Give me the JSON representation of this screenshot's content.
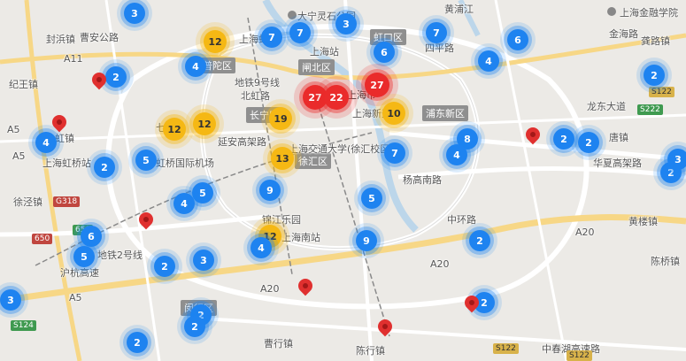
{
  "districts": [
    {
      "id": "putuo",
      "label": "普陀区"
    },
    {
      "id": "zhabei",
      "label": "闸北区"
    },
    {
      "id": "hongkou",
      "label": "虹口区"
    },
    {
      "id": "changning",
      "label": "长宁区"
    },
    {
      "id": "pudong",
      "label": "浦东新区"
    },
    {
      "id": "xuhui",
      "label": "徐汇区"
    },
    {
      "id": "minhang",
      "label": "闵行区"
    }
  ],
  "labels": [
    {
      "id": "fengbang",
      "text": "封浜镇"
    },
    {
      "id": "caojia",
      "text": "曹安公路"
    },
    {
      "id": "jiwang",
      "text": "纪王镇"
    },
    {
      "id": "hongqiao-zhen",
      "text": "虹镇"
    },
    {
      "id": "hongqiao-airport-station",
      "text": "上海虹桥站"
    },
    {
      "id": "hongqiao-airport",
      "text": "虹桥国际机场"
    },
    {
      "id": "xujing",
      "text": "徐泾镇"
    },
    {
      "id": "ditie2",
      "text": "地铁2号线"
    },
    {
      "id": "ditie9",
      "text": "地铁9号线"
    },
    {
      "id": "huangjiang",
      "text": "黄浦江"
    },
    {
      "id": "jinhai",
      "text": "金海路"
    },
    {
      "id": "gongyuan",
      "text": "龚路镇"
    },
    {
      "id": "longdong",
      "text": "龙东大道"
    },
    {
      "id": "tangzhen",
      "text": "唐镇"
    },
    {
      "id": "huaxia",
      "text": "华夏高架路"
    },
    {
      "id": "huanglou",
      "text": "黄楼镇"
    },
    {
      "id": "chenhang",
      "text": "陈桥镇"
    },
    {
      "id": "zhonghuan",
      "text": "中环路"
    },
    {
      "id": "yangg",
      "text": "杨高南路"
    },
    {
      "id": "shanghai-south",
      "text": "上海南站"
    },
    {
      "id": "sjtu",
      "text": "上海交通大学(徐汇校区)"
    },
    {
      "id": "dangyin",
      "text": "大宁灵石公园"
    },
    {
      "id": "shanghaishi",
      "text": "上海市"
    },
    {
      "id": "shanghai-jinrong",
      "text": "上海金融学院"
    },
    {
      "id": "ditie-yanan",
      "text": "延安高架路"
    },
    {
      "id": "a20",
      "text": "A20"
    },
    {
      "id": "a20b",
      "text": "A20"
    },
    {
      "id": "a20c",
      "text": "A20"
    },
    {
      "id": "a11",
      "text": "A11"
    },
    {
      "id": "a5",
      "text": "A5"
    },
    {
      "id": "a5b",
      "text": "A5"
    },
    {
      "id": "a5c",
      "text": "A5"
    },
    {
      "id": "jinjiang",
      "text": "锦江乐园"
    },
    {
      "id": "caohang",
      "text": "曹行镇"
    },
    {
      "id": "chenhuang",
      "text": "陈行镇"
    },
    {
      "id": "zhongchun",
      "text": "中春湖高速路"
    },
    {
      "id": "shanghai-yuan",
      "text": "上海虹桥"
    },
    {
      "id": "xinxin",
      "text": "上海新天地"
    },
    {
      "id": "sishui",
      "text": "四平路"
    },
    {
      "id": "beihu",
      "text": "北虹路"
    },
    {
      "id": "qibao",
      "text": "七宝镇"
    },
    {
      "id": "shanghai-nanjing",
      "text": "上海站"
    },
    {
      "id": "songjiang",
      "text": "沪杭高速"
    }
  ],
  "shields": [
    {
      "id": "g318",
      "text": "G318",
      "tone": "red"
    },
    {
      "id": "s124",
      "text": "S124",
      "tone": "green"
    },
    {
      "id": "s122",
      "text": "S122",
      "tone": "yellow"
    },
    {
      "id": "s122b",
      "text": "S122",
      "tone": "yellow"
    },
    {
      "id": "s650",
      "text": "650",
      "tone": "red"
    },
    {
      "id": "s650b",
      "text": "650",
      "tone": "green"
    },
    {
      "id": "s222",
      "text": "S222",
      "tone": "green"
    },
    {
      "id": "s122c",
      "text": "S122",
      "tone": "yellow"
    }
  ],
  "clusters": [
    {
      "count": "3",
      "tone": "blue"
    },
    {
      "count": "12",
      "tone": "yellow"
    },
    {
      "count": "7",
      "tone": "blue"
    },
    {
      "count": "7",
      "tone": "blue"
    },
    {
      "count": "3",
      "tone": "blue"
    },
    {
      "count": "7",
      "tone": "blue"
    },
    {
      "count": "6",
      "tone": "blue"
    },
    {
      "count": "4",
      "tone": "blue"
    },
    {
      "count": "6",
      "tone": "blue"
    },
    {
      "count": "2",
      "tone": "blue"
    },
    {
      "count": "2",
      "tone": "blue"
    },
    {
      "count": "4",
      "tone": "blue"
    },
    {
      "count": "27",
      "tone": "red"
    },
    {
      "count": "22",
      "tone": "red"
    },
    {
      "count": "27",
      "tone": "red"
    },
    {
      "count": "12",
      "tone": "yellow"
    },
    {
      "count": "12",
      "tone": "yellow"
    },
    {
      "count": "19",
      "tone": "yellow"
    },
    {
      "count": "10",
      "tone": "yellow"
    },
    {
      "count": "4",
      "tone": "blue"
    },
    {
      "count": "2",
      "tone": "blue"
    },
    {
      "count": "5",
      "tone": "blue"
    },
    {
      "count": "13",
      "tone": "yellow"
    },
    {
      "count": "7",
      "tone": "blue"
    },
    {
      "count": "8",
      "tone": "blue"
    },
    {
      "count": "4",
      "tone": "blue"
    },
    {
      "count": "2",
      "tone": "blue"
    },
    {
      "count": "2",
      "tone": "blue"
    },
    {
      "count": "2",
      "tone": "blue"
    },
    {
      "count": "3",
      "tone": "blue"
    },
    {
      "count": "5",
      "tone": "blue"
    },
    {
      "count": "4",
      "tone": "blue"
    },
    {
      "count": "9",
      "tone": "blue"
    },
    {
      "count": "5",
      "tone": "blue"
    },
    {
      "count": "6",
      "tone": "blue"
    },
    {
      "count": "5",
      "tone": "blue"
    },
    {
      "count": "12",
      "tone": "yellow"
    },
    {
      "count": "4",
      "tone": "blue"
    },
    {
      "count": "9",
      "tone": "blue"
    },
    {
      "count": "2",
      "tone": "blue"
    },
    {
      "count": "2",
      "tone": "blue"
    },
    {
      "count": "3",
      "tone": "blue"
    },
    {
      "count": "3",
      "tone": "blue"
    },
    {
      "count": "2",
      "tone": "blue"
    },
    {
      "count": "2",
      "tone": "blue"
    },
    {
      "count": "2",
      "tone": "blue"
    },
    {
      "count": "2",
      "tone": "blue"
    }
  ],
  "colors": {
    "background": "#eceae6",
    "road": "#ffffff",
    "highway": "#f7d786",
    "blue_cluster": "#1e83f0",
    "yellow_cluster": "#f5b814",
    "red_cluster": "#ea2b2b",
    "pin": "#e0302f"
  }
}
